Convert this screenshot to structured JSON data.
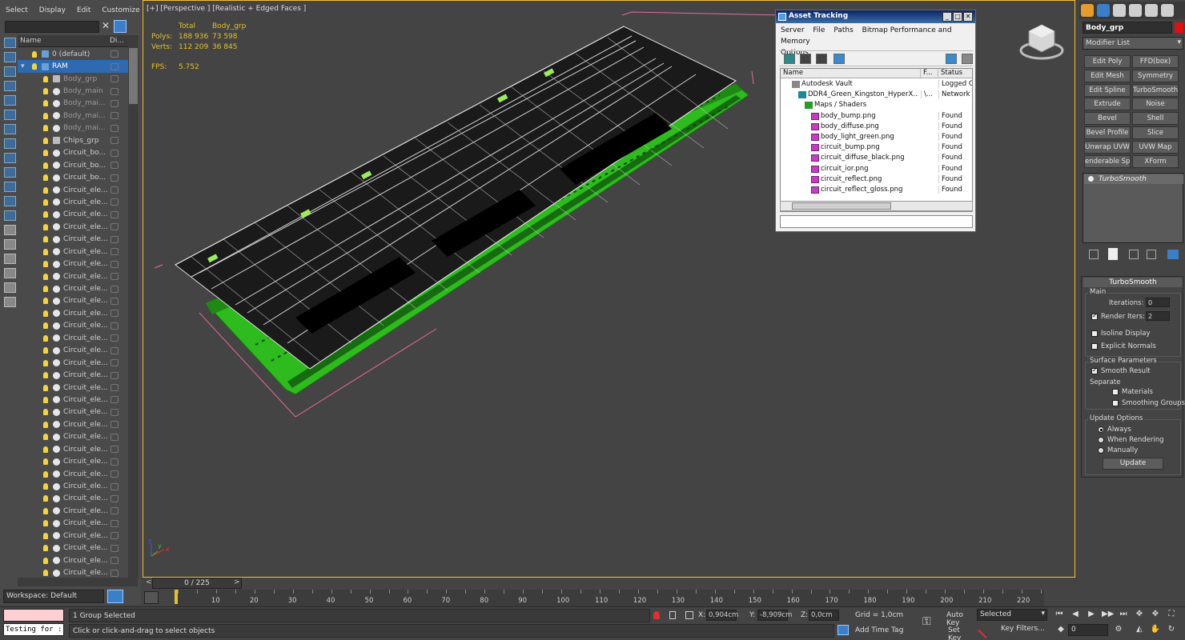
{
  "explorer": {
    "menu": [
      "Select",
      "Display",
      "Edit",
      "Customize"
    ],
    "columns": {
      "name": "Name",
      "display": "Di..."
    },
    "items": [
      {
        "label": "0 (default)",
        "level": 1,
        "kind": "layer",
        "state": "normal"
      },
      {
        "label": "RAM",
        "level": 1,
        "kind": "layer",
        "state": "selected"
      },
      {
        "label": "Body_grp",
        "level": 2,
        "kind": "group",
        "state": "grey"
      },
      {
        "label": "Body_main",
        "level": 2,
        "kind": "object",
        "state": "grey"
      },
      {
        "label": "Body_mai...",
        "level": 2,
        "kind": "object",
        "state": "grey"
      },
      {
        "label": "Body_mai...",
        "level": 2,
        "kind": "object",
        "state": "grey"
      },
      {
        "label": "Body_mai...",
        "level": 2,
        "kind": "object",
        "state": "grey"
      },
      {
        "label": "Chips_grp",
        "level": 2,
        "kind": "group",
        "state": "normal"
      },
      {
        "label": "Circuit_bo...",
        "level": 2,
        "kind": "object",
        "state": "normal"
      },
      {
        "label": "Circuit_bo...",
        "level": 2,
        "kind": "object",
        "state": "normal"
      },
      {
        "label": "Circuit_bo...",
        "level": 2,
        "kind": "object",
        "state": "normal"
      },
      {
        "label": "Circuit_ele...",
        "level": 2,
        "kind": "object",
        "state": "normal"
      },
      {
        "label": "Circuit_ele...",
        "level": 2,
        "kind": "object",
        "state": "normal"
      },
      {
        "label": "Circuit_ele...",
        "level": 2,
        "kind": "object",
        "state": "normal"
      },
      {
        "label": "Circuit_ele...",
        "level": 2,
        "kind": "object",
        "state": "normal"
      },
      {
        "label": "Circuit_ele...",
        "level": 2,
        "kind": "object",
        "state": "normal"
      },
      {
        "label": "Circuit_ele...",
        "level": 2,
        "kind": "object",
        "state": "normal"
      },
      {
        "label": "Circuit_ele...",
        "level": 2,
        "kind": "object",
        "state": "normal"
      },
      {
        "label": "Circuit_ele...",
        "level": 2,
        "kind": "object",
        "state": "normal"
      },
      {
        "label": "Circuit_ele...",
        "level": 2,
        "kind": "object",
        "state": "normal"
      },
      {
        "label": "Circuit_ele...",
        "level": 2,
        "kind": "object",
        "state": "normal"
      },
      {
        "label": "Circuit_ele...",
        "level": 2,
        "kind": "object",
        "state": "normal"
      },
      {
        "label": "Circuit_ele...",
        "level": 2,
        "kind": "object",
        "state": "normal"
      },
      {
        "label": "Circuit_ele...",
        "level": 2,
        "kind": "object",
        "state": "normal"
      },
      {
        "label": "Circuit_ele...",
        "level": 2,
        "kind": "object",
        "state": "normal"
      },
      {
        "label": "Circuit_ele...",
        "level": 2,
        "kind": "object",
        "state": "normal"
      },
      {
        "label": "Circuit_ele...",
        "level": 2,
        "kind": "object",
        "state": "normal"
      },
      {
        "label": "Circuit_ele...",
        "level": 2,
        "kind": "object",
        "state": "normal"
      },
      {
        "label": "Circuit_ele...",
        "level": 2,
        "kind": "object",
        "state": "normal"
      },
      {
        "label": "Circuit_ele...",
        "level": 2,
        "kind": "object",
        "state": "normal"
      },
      {
        "label": "Circuit_ele...",
        "level": 2,
        "kind": "object",
        "state": "normal"
      },
      {
        "label": "Circuit_ele...",
        "level": 2,
        "kind": "object",
        "state": "normal"
      },
      {
        "label": "Circuit_ele...",
        "level": 2,
        "kind": "object",
        "state": "normal"
      },
      {
        "label": "Circuit_ele...",
        "level": 2,
        "kind": "object",
        "state": "normal"
      },
      {
        "label": "Circuit_ele...",
        "level": 2,
        "kind": "object",
        "state": "normal"
      },
      {
        "label": "Circuit_ele...",
        "level": 2,
        "kind": "object",
        "state": "normal"
      },
      {
        "label": "Circuit_ele...",
        "level": 2,
        "kind": "object",
        "state": "normal"
      },
      {
        "label": "Circuit_ele...",
        "level": 2,
        "kind": "object",
        "state": "normal"
      },
      {
        "label": "Circuit_ele...",
        "level": 2,
        "kind": "object",
        "state": "normal"
      },
      {
        "label": "Circuit_ele...",
        "level": 2,
        "kind": "object",
        "state": "normal"
      },
      {
        "label": "Circuit_ele...",
        "level": 2,
        "kind": "object",
        "state": "normal"
      },
      {
        "label": "Circuit_ele...",
        "level": 2,
        "kind": "object",
        "state": "normal"
      },
      {
        "label": "Circuit_ele...",
        "level": 2,
        "kind": "object",
        "state": "normal"
      },
      {
        "label": "Circuit_ele...",
        "level": 2,
        "kind": "object",
        "state": "normal"
      }
    ],
    "workspace": "Workspace: Default"
  },
  "viewport": {
    "label": "[+] [Perspective ] [Realistic + Edged Faces ]",
    "stats": {
      "col_total": "Total",
      "col_sel": "Body_grp",
      "polys_label": "Polys:",
      "polys_total": "188 936",
      "polys_sel": "73 598",
      "verts_label": "Verts:",
      "verts_total": "112 209",
      "verts_sel": "36 845"
    },
    "fps_label": "FPS:",
    "fps_value": "5.752",
    "axis": {
      "x": "x",
      "y": "y",
      "z": "z"
    }
  },
  "asset_tracking": {
    "title": "Asset Tracking",
    "menu": [
      "Server",
      "File",
      "Paths",
      "Bitmap Performance and Memory",
      "Options"
    ],
    "columns": {
      "name": "Name",
      "full": "F...",
      "status": "Status"
    },
    "rows": [
      {
        "name": "Autodesk Vault",
        "full": "",
        "status": "Logged Out",
        "indent": 1,
        "icon": "vault"
      },
      {
        "name": "DDR4_Green_Kingston_HyperX...",
        "full": "\\...",
        "status": "Network Path",
        "indent": 2,
        "icon": "max"
      },
      {
        "name": "Maps / Shaders",
        "full": "",
        "status": "",
        "indent": 3,
        "icon": "maps"
      },
      {
        "name": "body_bump.png",
        "full": "",
        "status": "Found",
        "indent": 4,
        "icon": "png"
      },
      {
        "name": "body_diffuse.png",
        "full": "",
        "status": "Found",
        "indent": 4,
        "icon": "png"
      },
      {
        "name": "body_light_green.png",
        "full": "",
        "status": "Found",
        "indent": 4,
        "icon": "png"
      },
      {
        "name": "circuit_bump.png",
        "full": "",
        "status": "Found",
        "indent": 4,
        "icon": "png"
      },
      {
        "name": "circuit_diffuse_black.png",
        "full": "",
        "status": "Found",
        "indent": 4,
        "icon": "png"
      },
      {
        "name": "circuit_ior.png",
        "full": "",
        "status": "Found",
        "indent": 4,
        "icon": "png"
      },
      {
        "name": "circuit_reflect.png",
        "full": "",
        "status": "Found",
        "indent": 4,
        "icon": "png"
      },
      {
        "name": "circuit_reflect_gloss.png",
        "full": "",
        "status": "Found",
        "indent": 4,
        "icon": "png"
      }
    ]
  },
  "command_panel": {
    "object_name": "Body_grp",
    "object_color": "#e01010",
    "modifier_list": "Modifier List",
    "modifier_buttons": [
      "Edit Poly",
      "FFD(box)",
      "Edit Mesh",
      "Symmetry",
      "Edit Spline",
      "TurboSmooth",
      "Extrude",
      "Noise",
      "Bevel",
      "Shell",
      "Bevel Profile",
      "Slice",
      "Unwrap UVW",
      "UVW Map",
      "enderable Splin",
      "XForm"
    ],
    "stack_item": "TurboSmooth",
    "rollout": {
      "title": "TurboSmooth",
      "main_label": "Main",
      "iterations_label": "Iterations:",
      "iterations_value": "0",
      "render_iters_label": "Render Iters:",
      "render_iters_value": "2",
      "render_iters_checked": true,
      "isoline": "Isoline Display",
      "explicit_normals": "Explicit Normals",
      "surface_label": "Surface Parameters",
      "smooth_result": "Smooth Result",
      "separate_label": "Separate",
      "materials": "Materials",
      "smoothing_groups": "Smoothing Groups",
      "update_label": "Update Options",
      "always": "Always",
      "when_rendering": "When Rendering",
      "manually": "Manually",
      "update_button": "Update"
    }
  },
  "timeline": {
    "slider_text": "0 / 225",
    "ticks": [
      "10",
      "20",
      "30",
      "40",
      "50",
      "60",
      "70",
      "80",
      "90",
      "100",
      "110",
      "120",
      "130",
      "140",
      "150",
      "160",
      "170",
      "180",
      "190",
      "200",
      "210",
      "220"
    ],
    "max_frame": 225
  },
  "status": {
    "maxscript_text": "Testing for :",
    "selection": "1 Group Selected",
    "prompt": "Click or click-and-drag to select objects",
    "x_label": "X:",
    "x_value": "0,904cm",
    "y_label": "Y:",
    "y_value": "-8,909cm",
    "z_label": "Z:",
    "z_value": "0,0cm",
    "grid": "Grid = 1,0cm",
    "add_time_tag": "Add Time Tag",
    "auto_key": "Auto Key",
    "set_key": "Set Key",
    "selected_dropdown": "Selected",
    "key_filters": "Key Filters...",
    "frame": "0"
  },
  "colors": {
    "viewport_border": "#f2c232",
    "stats": "#e2c22c",
    "selection": "#2d6ab2",
    "pcb_green": "#2dbb1e"
  }
}
